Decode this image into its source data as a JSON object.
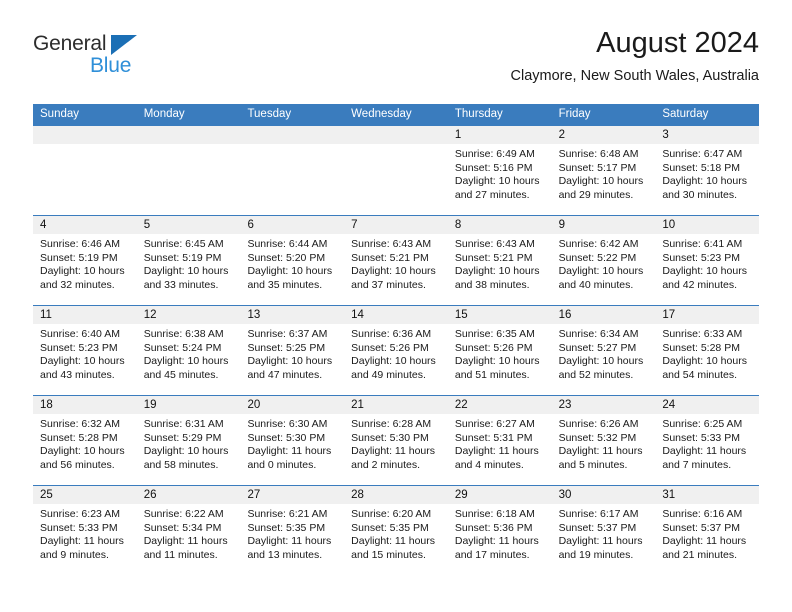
{
  "brand": {
    "word_top": "General",
    "word_bottom": "Blue",
    "accent_dark": "#2d2d2d",
    "accent_blue": "#2f8fd8",
    "triangle_color": "#1b6fb5"
  },
  "header": {
    "title": "August 2024",
    "subtitle": "Claymore, New South Wales, Australia"
  },
  "theme": {
    "header_bar": "#3a7cbe",
    "day_band": "#f0f0f0",
    "text": "#1a1a1a"
  },
  "weekdays": [
    "Sunday",
    "Monday",
    "Tuesday",
    "Wednesday",
    "Thursday",
    "Friday",
    "Saturday"
  ],
  "labels": {
    "sunrise_prefix": "Sunrise: ",
    "sunset_prefix": "Sunset: ",
    "daylight_prefix": "Daylight: "
  },
  "weeks": [
    [
      {
        "day": "",
        "empty": true
      },
      {
        "day": "",
        "empty": true
      },
      {
        "day": "",
        "empty": true
      },
      {
        "day": "",
        "empty": true
      },
      {
        "day": "1",
        "sunrise": "Sunrise: 6:49 AM",
        "sunset": "Sunset: 5:16 PM",
        "daylight_1": "Daylight: 10 hours",
        "daylight_2": "and 27 minutes."
      },
      {
        "day": "2",
        "sunrise": "Sunrise: 6:48 AM",
        "sunset": "Sunset: 5:17 PM",
        "daylight_1": "Daylight: 10 hours",
        "daylight_2": "and 29 minutes."
      },
      {
        "day": "3",
        "sunrise": "Sunrise: 6:47 AM",
        "sunset": "Sunset: 5:18 PM",
        "daylight_1": "Daylight: 10 hours",
        "daylight_2": "and 30 minutes."
      }
    ],
    [
      {
        "day": "4",
        "sunrise": "Sunrise: 6:46 AM",
        "sunset": "Sunset: 5:19 PM",
        "daylight_1": "Daylight: 10 hours",
        "daylight_2": "and 32 minutes."
      },
      {
        "day": "5",
        "sunrise": "Sunrise: 6:45 AM",
        "sunset": "Sunset: 5:19 PM",
        "daylight_1": "Daylight: 10 hours",
        "daylight_2": "and 33 minutes."
      },
      {
        "day": "6",
        "sunrise": "Sunrise: 6:44 AM",
        "sunset": "Sunset: 5:20 PM",
        "daylight_1": "Daylight: 10 hours",
        "daylight_2": "and 35 minutes."
      },
      {
        "day": "7",
        "sunrise": "Sunrise: 6:43 AM",
        "sunset": "Sunset: 5:21 PM",
        "daylight_1": "Daylight: 10 hours",
        "daylight_2": "and 37 minutes."
      },
      {
        "day": "8",
        "sunrise": "Sunrise: 6:43 AM",
        "sunset": "Sunset: 5:21 PM",
        "daylight_1": "Daylight: 10 hours",
        "daylight_2": "and 38 minutes."
      },
      {
        "day": "9",
        "sunrise": "Sunrise: 6:42 AM",
        "sunset": "Sunset: 5:22 PM",
        "daylight_1": "Daylight: 10 hours",
        "daylight_2": "and 40 minutes."
      },
      {
        "day": "10",
        "sunrise": "Sunrise: 6:41 AM",
        "sunset": "Sunset: 5:23 PM",
        "daylight_1": "Daylight: 10 hours",
        "daylight_2": "and 42 minutes."
      }
    ],
    [
      {
        "day": "11",
        "sunrise": "Sunrise: 6:40 AM",
        "sunset": "Sunset: 5:23 PM",
        "daylight_1": "Daylight: 10 hours",
        "daylight_2": "and 43 minutes."
      },
      {
        "day": "12",
        "sunrise": "Sunrise: 6:38 AM",
        "sunset": "Sunset: 5:24 PM",
        "daylight_1": "Daylight: 10 hours",
        "daylight_2": "and 45 minutes."
      },
      {
        "day": "13",
        "sunrise": "Sunrise: 6:37 AM",
        "sunset": "Sunset: 5:25 PM",
        "daylight_1": "Daylight: 10 hours",
        "daylight_2": "and 47 minutes."
      },
      {
        "day": "14",
        "sunrise": "Sunrise: 6:36 AM",
        "sunset": "Sunset: 5:26 PM",
        "daylight_1": "Daylight: 10 hours",
        "daylight_2": "and 49 minutes."
      },
      {
        "day": "15",
        "sunrise": "Sunrise: 6:35 AM",
        "sunset": "Sunset: 5:26 PM",
        "daylight_1": "Daylight: 10 hours",
        "daylight_2": "and 51 minutes."
      },
      {
        "day": "16",
        "sunrise": "Sunrise: 6:34 AM",
        "sunset": "Sunset: 5:27 PM",
        "daylight_1": "Daylight: 10 hours",
        "daylight_2": "and 52 minutes."
      },
      {
        "day": "17",
        "sunrise": "Sunrise: 6:33 AM",
        "sunset": "Sunset: 5:28 PM",
        "daylight_1": "Daylight: 10 hours",
        "daylight_2": "and 54 minutes."
      }
    ],
    [
      {
        "day": "18",
        "sunrise": "Sunrise: 6:32 AM",
        "sunset": "Sunset: 5:28 PM",
        "daylight_1": "Daylight: 10 hours",
        "daylight_2": "and 56 minutes."
      },
      {
        "day": "19",
        "sunrise": "Sunrise: 6:31 AM",
        "sunset": "Sunset: 5:29 PM",
        "daylight_1": "Daylight: 10 hours",
        "daylight_2": "and 58 minutes."
      },
      {
        "day": "20",
        "sunrise": "Sunrise: 6:30 AM",
        "sunset": "Sunset: 5:30 PM",
        "daylight_1": "Daylight: 11 hours",
        "daylight_2": "and 0 minutes."
      },
      {
        "day": "21",
        "sunrise": "Sunrise: 6:28 AM",
        "sunset": "Sunset: 5:30 PM",
        "daylight_1": "Daylight: 11 hours",
        "daylight_2": "and 2 minutes."
      },
      {
        "day": "22",
        "sunrise": "Sunrise: 6:27 AM",
        "sunset": "Sunset: 5:31 PM",
        "daylight_1": "Daylight: 11 hours",
        "daylight_2": "and 4 minutes."
      },
      {
        "day": "23",
        "sunrise": "Sunrise: 6:26 AM",
        "sunset": "Sunset: 5:32 PM",
        "daylight_1": "Daylight: 11 hours",
        "daylight_2": "and 5 minutes."
      },
      {
        "day": "24",
        "sunrise": "Sunrise: 6:25 AM",
        "sunset": "Sunset: 5:33 PM",
        "daylight_1": "Daylight: 11 hours",
        "daylight_2": "and 7 minutes."
      }
    ],
    [
      {
        "day": "25",
        "sunrise": "Sunrise: 6:23 AM",
        "sunset": "Sunset: 5:33 PM",
        "daylight_1": "Daylight: 11 hours",
        "daylight_2": "and 9 minutes."
      },
      {
        "day": "26",
        "sunrise": "Sunrise: 6:22 AM",
        "sunset": "Sunset: 5:34 PM",
        "daylight_1": "Daylight: 11 hours",
        "daylight_2": "and 11 minutes."
      },
      {
        "day": "27",
        "sunrise": "Sunrise: 6:21 AM",
        "sunset": "Sunset: 5:35 PM",
        "daylight_1": "Daylight: 11 hours",
        "daylight_2": "and 13 minutes."
      },
      {
        "day": "28",
        "sunrise": "Sunrise: 6:20 AM",
        "sunset": "Sunset: 5:35 PM",
        "daylight_1": "Daylight: 11 hours",
        "daylight_2": "and 15 minutes."
      },
      {
        "day": "29",
        "sunrise": "Sunrise: 6:18 AM",
        "sunset": "Sunset: 5:36 PM",
        "daylight_1": "Daylight: 11 hours",
        "daylight_2": "and 17 minutes."
      },
      {
        "day": "30",
        "sunrise": "Sunrise: 6:17 AM",
        "sunset": "Sunset: 5:37 PM",
        "daylight_1": "Daylight: 11 hours",
        "daylight_2": "and 19 minutes."
      },
      {
        "day": "31",
        "sunrise": "Sunrise: 6:16 AM",
        "sunset": "Sunset: 5:37 PM",
        "daylight_1": "Daylight: 11 hours",
        "daylight_2": "and 21 minutes."
      }
    ]
  ]
}
